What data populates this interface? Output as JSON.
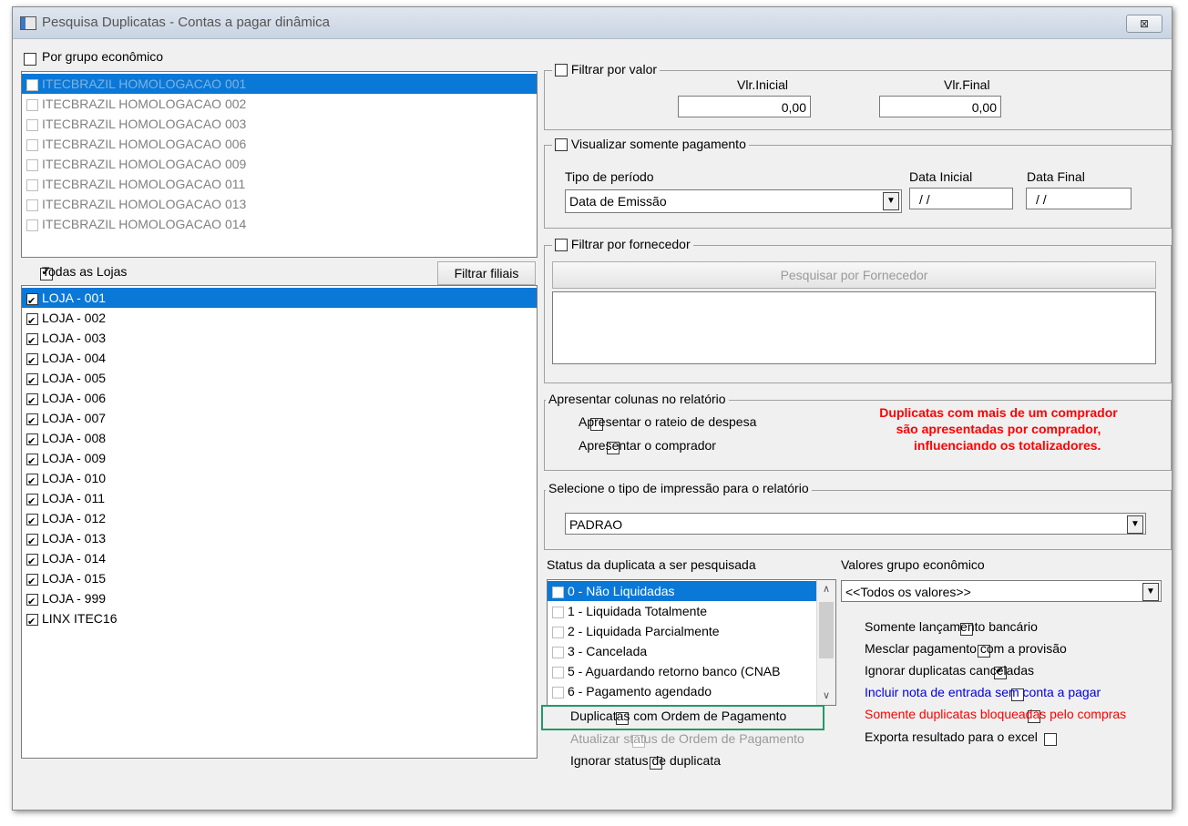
{
  "window": {
    "title": "Pesquisa Duplicatas - Contas a pagar dinâmica",
    "close_glyph": "⊠"
  },
  "grupo": {
    "label": "Por grupo econômico",
    "items": [
      "ITECBRAZIL HOMOLOGACAO 001",
      "ITECBRAZIL HOMOLOGACAO 002",
      "ITECBRAZIL HOMOLOGACAO 003",
      "ITECBRAZIL HOMOLOGACAO 006",
      "ITECBRAZIL HOMOLOGACAO 009",
      "ITECBRAZIL HOMOLOGACAO 011",
      "ITECBRAZIL HOMOLOGACAO 013",
      "ITECBRAZIL HOMOLOGACAO 014"
    ]
  },
  "lojas": {
    "label": "Todas as Lojas",
    "filter_button": "Filtrar filiais",
    "items": [
      "LOJA - 001",
      "LOJA - 002",
      "LOJA - 003",
      "LOJA - 004",
      "LOJA - 005",
      "LOJA - 006",
      "LOJA - 007",
      "LOJA - 008",
      "LOJA - 009",
      "LOJA - 010",
      "LOJA - 011",
      "LOJA - 012",
      "LOJA - 013",
      "LOJA - 014",
      "LOJA - 015",
      "LOJA - 999",
      "LINX ITEC16"
    ]
  },
  "valor": {
    "legend": "Filtrar por valor",
    "inicial_label": "Vlr.Inicial",
    "inicial_value": "0,00",
    "final_label": "Vlr.Final",
    "final_value": "0,00"
  },
  "pagamento": {
    "legend": "Visualizar somente pagamento",
    "tipo_label": "Tipo de período",
    "tipo_value": "Data de Emissão",
    "data_inicial_label": "Data Inicial",
    "data_inicial_value": "/ /",
    "data_final_label": "Data Final",
    "data_final_value": "/ /"
  },
  "fornecedor": {
    "legend": "Filtrar por fornecedor",
    "button": "Pesquisar por Fornecedor"
  },
  "colunas": {
    "legend": "Apresentar colunas no relatório",
    "rateio": "Apresentar o rateio de despesa",
    "comprador": "Apresentar o comprador",
    "warning": "Duplicatas com mais de um comprador\nsão apresentadas por comprador,\n     influenciando os totalizadores."
  },
  "impressao": {
    "legend": "Selecione o tipo de impressão para o relatório",
    "value": "PADRAO"
  },
  "status": {
    "label": "Status da duplicata a ser pesquisada",
    "items": [
      "0 - Não Liquidadas",
      "1 - Liquidada Totalmente",
      "2 - Liquidada Parcialmente",
      "3 - Cancelada",
      "5 - Aguardando retorno banco (CNAB",
      "6 - Pagamento agendado"
    ],
    "ordem": "Duplicatas com Ordem de Pagamento",
    "atualizar": "Atualizar status de Ordem de Pagamento",
    "ignorar": "Ignorar status de duplicata"
  },
  "valores_grupo": {
    "label": "Valores grupo econômico",
    "value": "<<Todos os valores>>",
    "opt1": "Somente lançamento bancário",
    "opt2": "Mesclar pagamento com a provisão",
    "opt3": "Ignorar duplicatas canceladas",
    "opt4": "Incluir nota de entrada sem conta a pagar",
    "opt5": "Somente duplicatas bloqueadas pelo compras",
    "opt6": "Exporta resultado para o excel"
  },
  "colors": {
    "selection": "#0a78d7",
    "warning": "#ff0000",
    "link_blue": "#0000e0",
    "highlight_border": "#1f9a6a"
  }
}
